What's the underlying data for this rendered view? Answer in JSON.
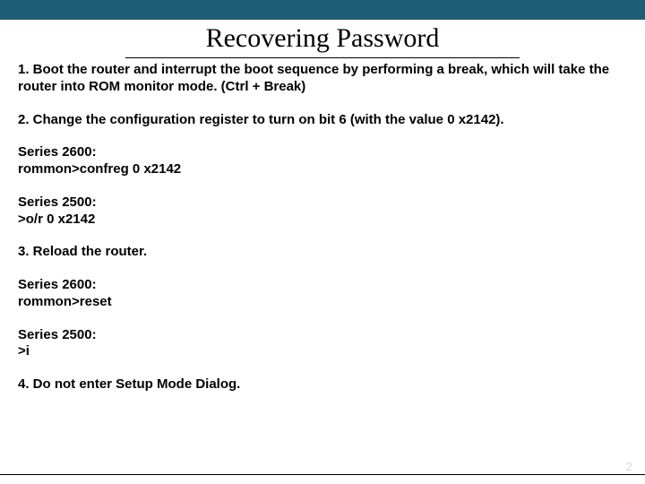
{
  "title": "Recovering Password",
  "steps": {
    "s1_lead": "1. Boot the router and interrupt the boot sequence by performing a break, which will take the router into ROM monitor mode. ",
    "s1_key": "(Ctrl + Break)",
    "s2": "2. Change the configuration register to turn on bit 6 (with the value 0 x2142).",
    "s3": "3. Reload the router.",
    "s4": "4. Do not enter Setup Mode Dialog."
  },
  "cmds": {
    "s2600_label": "Series 2600:",
    "s2600_confreg": "rommon>confreg 0 x2142",
    "s2500_label": "Series 2500:",
    "s2500_or": ">o/r 0 x2142",
    "s2600_reset": "rommon>reset",
    "s2500_i": ">i"
  },
  "page_number": "2"
}
